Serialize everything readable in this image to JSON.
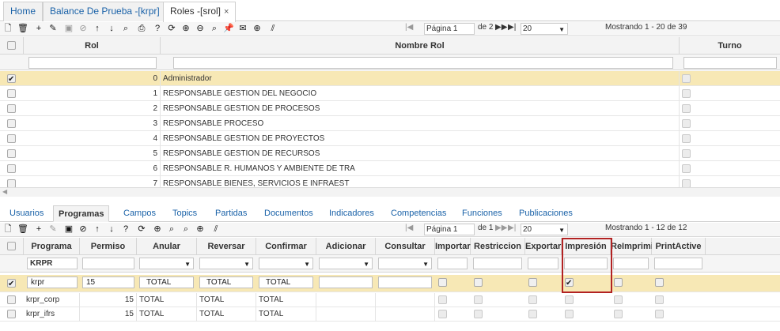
{
  "tabs": [
    {
      "label": "Home",
      "close": ""
    },
    {
      "label": "Balance De Prueba -[krpr]",
      "close": "×"
    },
    {
      "label": "Roles -[srol]",
      "close": "×"
    }
  ],
  "toolbar1": {
    "first_icon": "|◀",
    "prev_icon": "◀◀",
    "page_label": "Página 1",
    "of_pages": "de 2",
    "next_icon": "▶▶",
    "last_icon": "▶|",
    "page_size": "20",
    "showing": "Mostrando 1 - 20 de 39"
  },
  "roles_grid": {
    "headers": {
      "rol": "Rol",
      "nombre": "Nombre Rol",
      "turno": "Turno"
    },
    "rows": [
      {
        "id": "0",
        "name": "Administrador",
        "checked": true
      },
      {
        "id": "1",
        "name": "RESPONSABLE GESTION DEL NEGOCIO",
        "checked": false
      },
      {
        "id": "2",
        "name": "RESPONSABLE GESTION DE PROCESOS",
        "checked": false
      },
      {
        "id": "3",
        "name": "RESPONSABLE PROCESO",
        "checked": false
      },
      {
        "id": "4",
        "name": "RESPONSABLE GESTION DE PROYECTOS",
        "checked": false
      },
      {
        "id": "5",
        "name": "RESPONSABLE GESTION DE RECURSOS",
        "checked": false
      },
      {
        "id": "6",
        "name": "RESPONSABLE R. HUMANOS Y AMBIENTE DE TRA",
        "checked": false
      },
      {
        "id": "7",
        "name": "RESPONSABLE BIENES, SERVICIOS E INFRAEST",
        "checked": false
      }
    ]
  },
  "subtabs": [
    "Usuarios",
    "Programas",
    "Campos",
    "Topics",
    "Partidas",
    "Documentos",
    "Indicadores",
    "Competencias",
    "Funciones",
    "Publicaciones"
  ],
  "toolbar2": {
    "page_label": "Página 1",
    "of_pages": "de 1",
    "page_size": "20",
    "showing": "Mostrando 1 - 12 de 12"
  },
  "programs_grid": {
    "headers": {
      "programa": "Programa",
      "permiso": "Permiso",
      "anular": "Anular",
      "reversar": "Reversar",
      "confirmar": "Confirmar",
      "adicionar": "Adicionar",
      "consultar": "Consultar",
      "importar": "Importar",
      "restriccion": "Restriccion",
      "exportar": "Exportar",
      "impresion": "Impresión",
      "reimprimir": "ReImprimi",
      "printactive": "PrintActive"
    },
    "filter": {
      "programa": "KRPR"
    },
    "edit_row": {
      "programa": "krpr",
      "permiso": "15",
      "anular": "TOTAL",
      "reversar": "TOTAL",
      "confirmar": "TOTAL"
    },
    "rows": [
      {
        "programa": "krpr_corp",
        "permiso": "15",
        "anular": "TOTAL",
        "reversar": "TOTAL",
        "confirmar": "TOTAL"
      },
      {
        "programa": "krpr_ifrs",
        "permiso": "15",
        "anular": "TOTAL",
        "reversar": "TOTAL",
        "confirmar": "TOTAL"
      }
    ]
  },
  "colors": {
    "selected_row": "#f7e8b5",
    "link": "#1a62a8",
    "highlight": "#b22222"
  }
}
